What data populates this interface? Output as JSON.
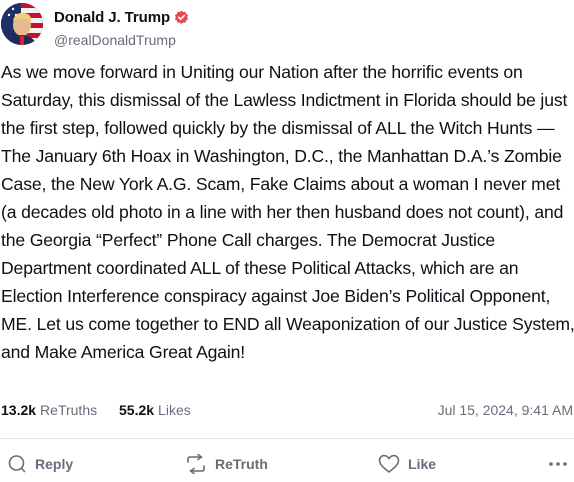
{
  "author": {
    "display_name": "Donald J. Trump",
    "handle": "@realDonaldTrump"
  },
  "post": {
    "text": "As we move forward in Uniting our Nation after the horrific events on Saturday, this dismissal of the Lawless Indictment in Florida should be just the first step, followed quickly by the dismissal of ALL the Witch Hunts — The January 6th Hoax in Washington, D.C., the Manhattan D.A.’s Zombie Case, the New York A.G. Scam, Fake Claims about a woman I never met (a decades old photo in a line with her then husband does not count), and the Georgia “Perfect” Phone Call charges. The Democrat Justice Department coordinated ALL of these Political Attacks, which are an Election Interference conspiracy against Joe Biden’s Political Opponent, ME. Let us come together to END all Weaponization of our Justice System, and Make America Great Again!",
    "retruths_count": "13.2k",
    "retruths_label": "ReTruths",
    "likes_count": "55.2k",
    "likes_label": "Likes",
    "timestamp": "Jul 15, 2024, 9:41 AM"
  },
  "actions": {
    "reply_label": "Reply",
    "retruth_label": "ReTruth",
    "like_label": "Like"
  },
  "icons": {
    "verified": "verified-badge-icon",
    "reply": "speech-bubble-icon",
    "retruth": "retruth-arrows-icon",
    "like": "heart-icon",
    "more": "more-dots-icon"
  },
  "colors": {
    "verified_badge": "#e8484f",
    "text_primary": "#0f0f17",
    "text_secondary": "#6b6b7b",
    "divider": "#e8e8ee"
  }
}
